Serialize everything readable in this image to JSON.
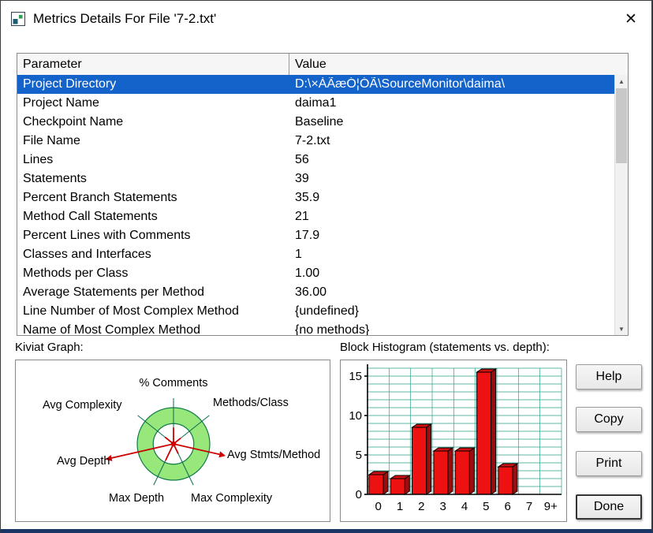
{
  "window": {
    "title": "Metrics Details For File '7-2.txt'",
    "close_glyph": "✕"
  },
  "table": {
    "columns": [
      "Parameter",
      "Value"
    ],
    "rows": [
      {
        "parameter": "Project Directory",
        "value": "D:\\×ÀÃæÓ¦ÓÃ\\SourceMonitor\\daima\\",
        "selected": true
      },
      {
        "parameter": "Project Name",
        "value": "daima1",
        "selected": false
      },
      {
        "parameter": "Checkpoint Name",
        "value": "Baseline",
        "selected": false
      },
      {
        "parameter": "File Name",
        "value": "7-2.txt",
        "selected": false
      },
      {
        "parameter": "Lines",
        "value": "56",
        "selected": false
      },
      {
        "parameter": "Statements",
        "value": "39",
        "selected": false
      },
      {
        "parameter": "Percent Branch Statements",
        "value": "35.9",
        "selected": false
      },
      {
        "parameter": "Method Call Statements",
        "value": "21",
        "selected": false
      },
      {
        "parameter": "Percent Lines with Comments",
        "value": "17.9",
        "selected": false
      },
      {
        "parameter": "Classes and Interfaces",
        "value": "1",
        "selected": false
      },
      {
        "parameter": "Methods per Class",
        "value": "1.00",
        "selected": false
      },
      {
        "parameter": "Average Statements per Method",
        "value": "36.00",
        "selected": false
      },
      {
        "parameter": "Line Number of Most Complex Method",
        "value": "{undefined}",
        "selected": false
      },
      {
        "parameter": "Name of Most Complex Method",
        "value": "{no methods}",
        "selected": false
      }
    ]
  },
  "scrollbar": {
    "up_glyph": "▲",
    "down_glyph": "▼"
  },
  "buttons": [
    {
      "label": "Help"
    },
    {
      "label": "Copy"
    },
    {
      "label": "Print"
    },
    {
      "label": "Done",
      "default": true
    }
  ],
  "colors": {
    "selection": "#1363cb",
    "selection_text": "#ffffff",
    "window_edge": "#1a3666"
  },
  "chart_data": [
    {
      "type": "bar",
      "title": "Block Histogram (statements vs. depth):",
      "categories": [
        "0",
        "1",
        "2",
        "3",
        "4",
        "5",
        "6",
        "7",
        "9+"
      ],
      "values": [
        2.5,
        2,
        8.5,
        5.5,
        5.5,
        15.5,
        3.5,
        0,
        0
      ],
      "xlabel": "depth",
      "ylabel": "statements",
      "yticks": [
        0,
        5,
        10,
        15
      ],
      "ylim": [
        0,
        16
      ],
      "grid": true,
      "grid_color": "#2aa188",
      "bar_color": "#ee1111",
      "bar_top_color": "#cf1010",
      "bar_side_color": "#9c0d0d"
    },
    {
      "type": "radar",
      "title": "Kiviat Graph:",
      "axes": [
        "% Comments",
        "Methods/Class",
        "Avg Stmts/Method",
        "Max Complexity",
        "Max Depth",
        "Avg Depth",
        "Avg Complexity"
      ],
      "values_normalized": [
        0.45,
        0.25,
        1.3,
        0.3,
        0.5,
        1.75,
        0.3
      ],
      "ring": {
        "inner_ratio": 0.56,
        "fill": "#97e77a",
        "outline": "#0f7a4a"
      },
      "axis_color": "#0b6b4e",
      "spoke_color": "#cc0000"
    }
  ]
}
